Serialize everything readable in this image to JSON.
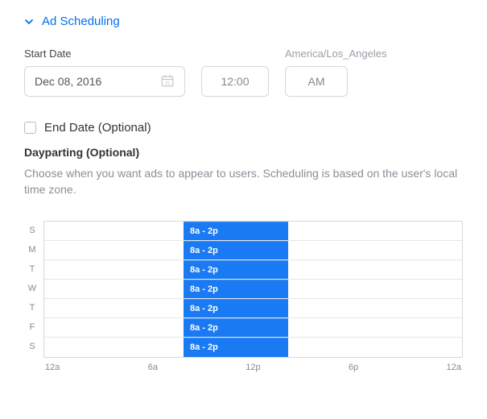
{
  "section": {
    "title": "Ad Scheduling"
  },
  "startDate": {
    "label": "Start Date",
    "value": "Dec 08, 2016",
    "time": "12:00",
    "ampm": "AM"
  },
  "timezone": "America/Los_Angeles",
  "endDate": {
    "label": "End Date (Optional)",
    "checked": false
  },
  "dayparting": {
    "label": "Dayparting (Optional)",
    "helper": "Choose when you want ads to appear to users. Scheduling is based on the user's local time zone.",
    "days": [
      "S",
      "M",
      "T",
      "W",
      "T",
      "F",
      "S"
    ],
    "selectionLabel": "8a - 2p",
    "xaxis": [
      "12a",
      "6a",
      "12p",
      "6p",
      "12a"
    ]
  }
}
